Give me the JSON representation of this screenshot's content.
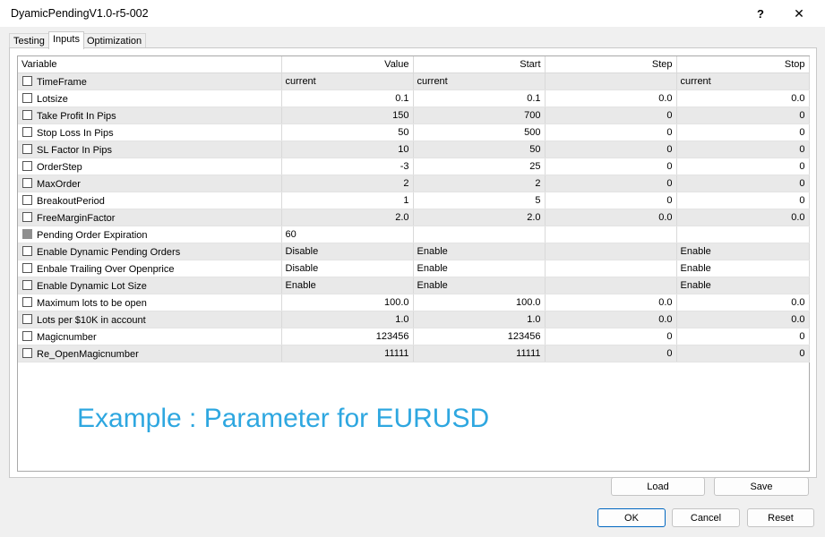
{
  "window": {
    "title": "DyamicPendingV1.0-r5-002",
    "help_label": "?",
    "close_label": "✕"
  },
  "tabs": [
    {
      "label": "Testing"
    },
    {
      "label": "Inputs",
      "active": true
    },
    {
      "label": "Optimization"
    }
  ],
  "grid": {
    "columns": {
      "variable": "Variable",
      "value": "Value",
      "start": "Start",
      "step": "Step",
      "stop": "Stop"
    },
    "rows": [
      {
        "name": "TimeFrame",
        "value": "current",
        "start": "current",
        "step": "",
        "stop": "current",
        "type": "text"
      },
      {
        "name": "Lotsize",
        "value": "0.1",
        "start": "0.1",
        "step": "0.0",
        "stop": "0.0",
        "type": "num"
      },
      {
        "name": "Take Profit In Pips",
        "value": "150",
        "start": "700",
        "step": "0",
        "stop": "0",
        "type": "num"
      },
      {
        "name": "Stop Loss In Pips",
        "value": "50",
        "start": "500",
        "step": "0",
        "stop": "0",
        "type": "num"
      },
      {
        "name": "SL Factor In Pips",
        "value": "10",
        "start": "50",
        "step": "0",
        "stop": "0",
        "type": "num"
      },
      {
        "name": "OrderStep",
        "value": "-3",
        "start": "25",
        "step": "0",
        "stop": "0",
        "type": "num"
      },
      {
        "name": "MaxOrder",
        "value": "2",
        "start": "2",
        "step": "0",
        "stop": "0",
        "type": "num"
      },
      {
        "name": "BreakoutPeriod",
        "value": "1",
        "start": "5",
        "step": "0",
        "stop": "0",
        "type": "num"
      },
      {
        "name": "FreeMarginFactor",
        "value": "2.0",
        "start": "2.0",
        "step": "0.0",
        "stop": "0.0",
        "type": "num"
      },
      {
        "name": "Pending Order Expiration",
        "value": "60",
        "start": "",
        "step": "",
        "stop": "",
        "type": "text",
        "disabled": true
      },
      {
        "name": "Enable Dynamic Pending Orders",
        "value": "Disable",
        "start": "Enable",
        "step": "",
        "stop": "Enable",
        "type": "text"
      },
      {
        "name": "Enbale Trailing Over Openprice",
        "value": "Disable",
        "start": "Enable",
        "step": "",
        "stop": "Enable",
        "type": "text"
      },
      {
        "name": "Enable Dynamic Lot Size",
        "value": "Enable",
        "start": "Enable",
        "step": "",
        "stop": "Enable",
        "type": "text"
      },
      {
        "name": "Maximum lots to be open",
        "value": "100.0",
        "start": "100.0",
        "step": "0.0",
        "stop": "0.0",
        "type": "num"
      },
      {
        "name": "Lots per $10K in account",
        "value": "1.0",
        "start": "1.0",
        "step": "0.0",
        "stop": "0.0",
        "type": "num"
      },
      {
        "name": "Magicnumber",
        "value": "123456",
        "start": "123456",
        "step": "0",
        "stop": "0",
        "type": "num"
      },
      {
        "name": "Re_OpenMagicnumber",
        "value": "11111",
        "start": "11111",
        "step": "0",
        "stop": "0",
        "type": "num"
      }
    ]
  },
  "overlay_text": "Example : Parameter for EURUSD",
  "buttons": {
    "load": "Load",
    "save": "Save",
    "ok": "OK",
    "cancel": "Cancel",
    "reset": "Reset"
  }
}
